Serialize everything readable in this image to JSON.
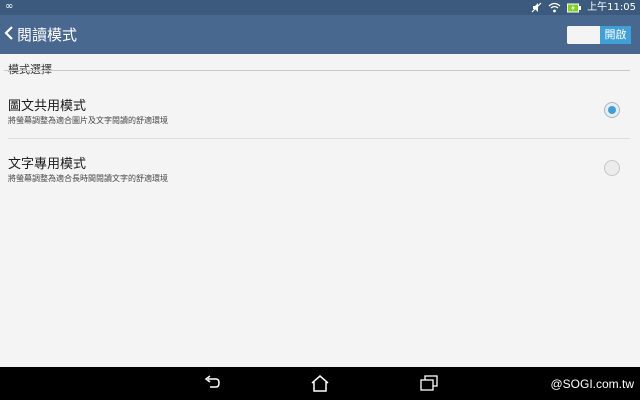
{
  "status_bar": {
    "left_icon": "infinity-icon",
    "time": "上午11:05",
    "icons": [
      "mute-icon",
      "wifi-icon",
      "battery-charging-icon"
    ]
  },
  "action_bar": {
    "back_icon": "chevron-left-icon",
    "title": "閱讀模式",
    "toggle": {
      "label": "開啟",
      "state": "on"
    }
  },
  "section": {
    "header": "模式選擇",
    "options": [
      {
        "title": "圖文共用模式",
        "subtitle": "將螢幕調整為適合圖片及文字閱讀的舒適環境",
        "selected": true
      },
      {
        "title": "文字專用模式",
        "subtitle": "將螢幕調整為適合長時間閱讀文字的舒適環境",
        "selected": false
      }
    ]
  },
  "nav_bar": {
    "buttons": [
      "back-icon",
      "home-icon",
      "recent-apps-icon"
    ],
    "watermark": "@SOGI.com.tw"
  },
  "colors": {
    "status_bar": "#3c5a7e",
    "action_bar": "#486890",
    "accent": "#3fa0d8",
    "background": "#f4f4f4"
  }
}
